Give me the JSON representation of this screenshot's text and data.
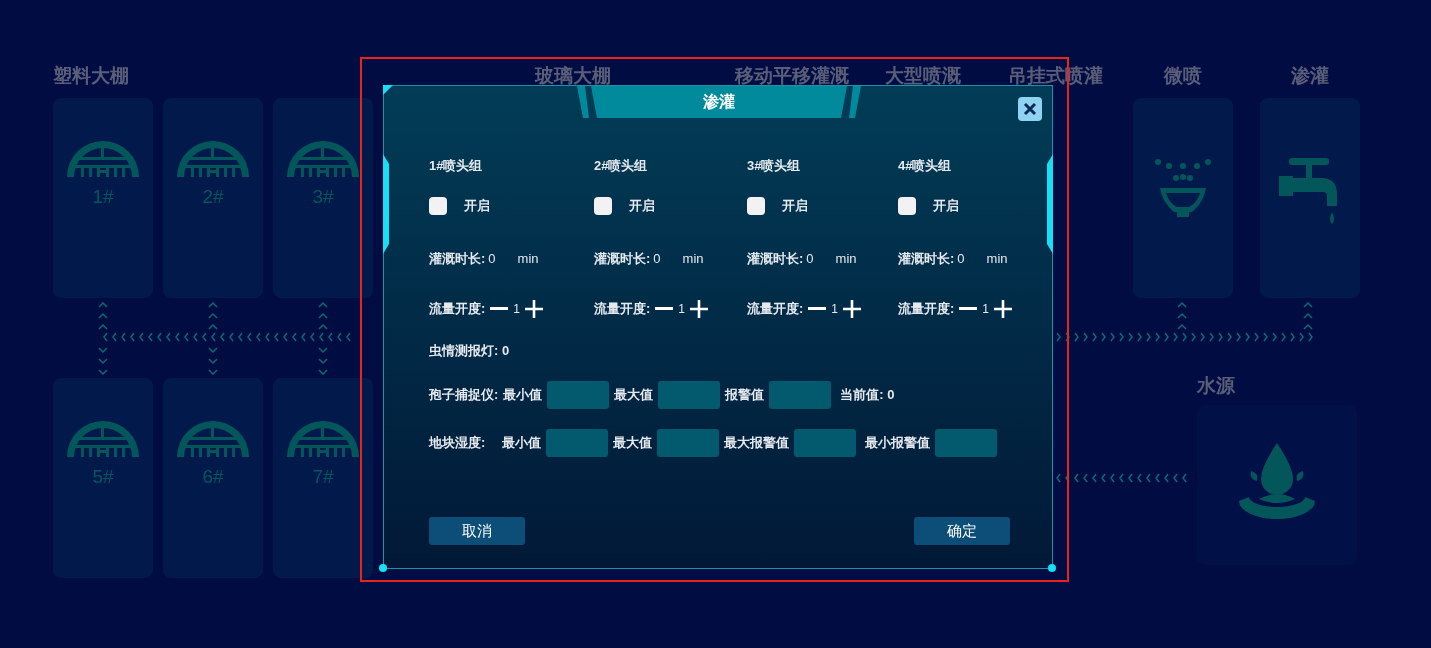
{
  "background": {
    "header_labels": [
      {
        "text": "玻璃大棚"
      },
      {
        "text": "移动平移灌溉"
      },
      {
        "text": "大型喷溉"
      },
      {
        "text": "吊挂式喷灌"
      }
    ],
    "plastic_greenhouse": {
      "title": "塑料大棚",
      "cards": [
        {
          "label": "1#"
        },
        {
          "label": "2#"
        },
        {
          "label": "3#"
        },
        {
          "label": "5#"
        },
        {
          "label": "6#"
        },
        {
          "label": "7#"
        }
      ]
    },
    "devices": [
      {
        "title": "微喷",
        "kind": "sprinkler"
      },
      {
        "title": "渗灌",
        "kind": "faucet"
      }
    ],
    "water_source": {
      "title": "水源"
    }
  },
  "dialog": {
    "title": "渗灌",
    "groups": [
      {
        "name": "1#喷头组",
        "switch_label": "开启",
        "checked": false,
        "duration_label": "灌溉时长:",
        "duration": "0",
        "unit": "min",
        "flow_label": "流量开度:",
        "flow": "1"
      },
      {
        "name": "2#喷头组",
        "switch_label": "开启",
        "checked": false,
        "duration_label": "灌溉时长:",
        "duration": "0",
        "unit": "min",
        "flow_label": "流量开度:",
        "flow": "1"
      },
      {
        "name": "3#喷头组",
        "switch_label": "开启",
        "checked": false,
        "duration_label": "灌溉时长:",
        "duration": "0",
        "unit": "min",
        "flow_label": "流量开度:",
        "flow": "1"
      },
      {
        "name": "4#喷头组",
        "switch_label": "开启",
        "checked": false,
        "duration_label": "灌溉时长:",
        "duration": "0",
        "unit": "min",
        "flow_label": "流量开度:",
        "flow": "1"
      }
    ],
    "pest_lamp": "虫情测报灯: 0",
    "spore_trap": {
      "label": "孢子捕捉仪:",
      "fields": [
        {
          "label": "最小值"
        },
        {
          "label": "最大值"
        },
        {
          "label": "报警值"
        }
      ],
      "current": "当前值: 0"
    },
    "soil_humidity": {
      "label": "地块湿度:",
      "fields": [
        {
          "label": "最小值"
        },
        {
          "label": "最大值"
        },
        {
          "label": "最大报警值"
        },
        {
          "label": "最小报警值"
        }
      ]
    },
    "buttons": [
      {
        "label": "取消"
      },
      {
        "label": "确定"
      }
    ]
  }
}
